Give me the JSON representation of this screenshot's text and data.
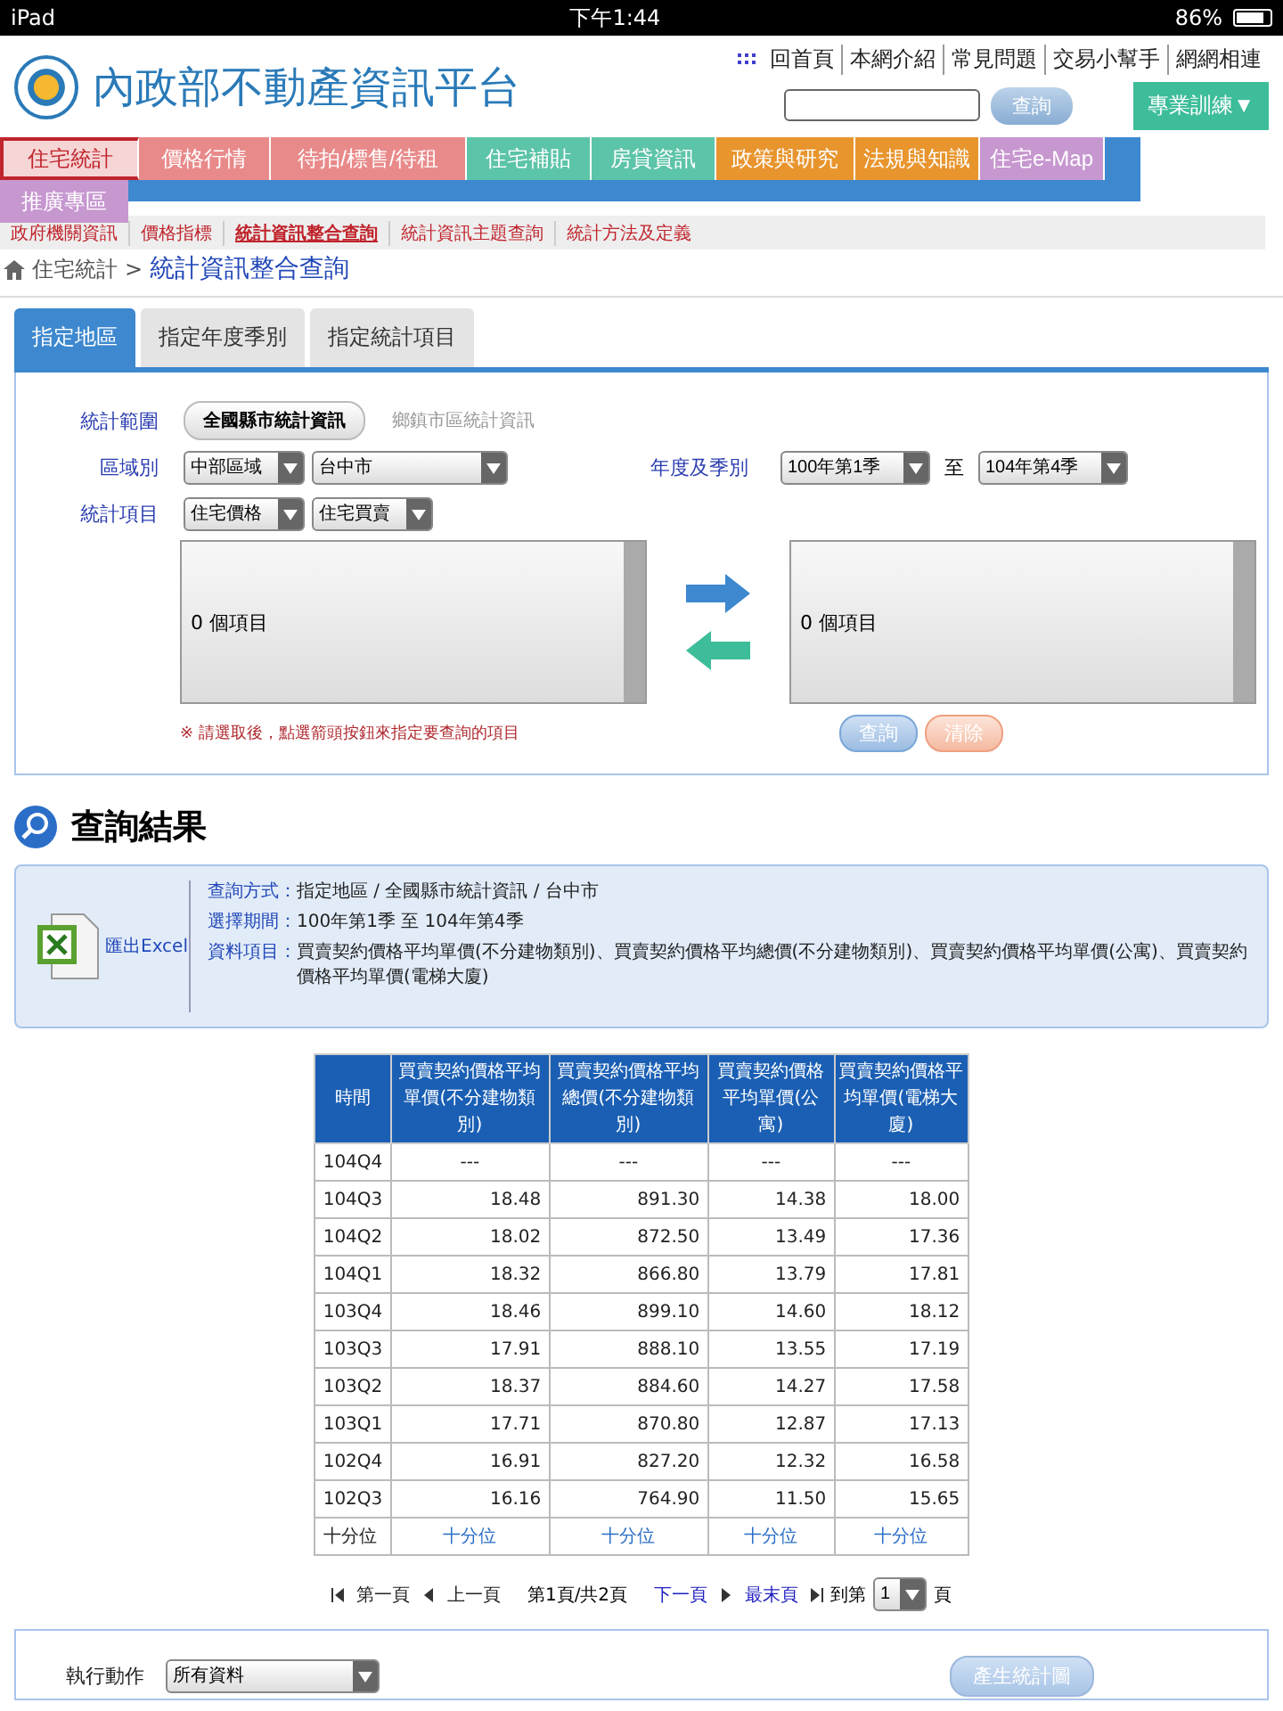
{
  "status_bar": {
    "device": "iPad",
    "time": "下午1:44",
    "battery": "86%"
  },
  "header": {
    "site_title": "內政部不動產資訊平台",
    "top_links": [
      "回首頁",
      "本網介紹",
      "常見問題",
      "交易小幫手",
      "網網相連"
    ],
    "search": {
      "button": "查詢"
    },
    "training_button": "專業訓練▼"
  },
  "nav": [
    {
      "label": "住宅統計",
      "color": "#f6d5d5",
      "selected": true
    },
    {
      "label": "價格行情",
      "color": "#e98a8a",
      "selected": false
    },
    {
      "label": "待拍/標售/待租",
      "color": "#e98a8a",
      "selected": false
    },
    {
      "label": "住宅補貼",
      "color": "#5cc4a8",
      "selected": false
    },
    {
      "label": "房貸資訊",
      "color": "#5cc4a8",
      "selected": false
    },
    {
      "label": "政策與研究",
      "color": "#e8952e",
      "selected": false
    },
    {
      "label": "法規與知識",
      "color": "#e8952e",
      "selected": false
    },
    {
      "label": "住宅e-Map",
      "color": "#c797d0",
      "selected": false
    },
    {
      "label": "推廣專區",
      "color": "#c797d0",
      "selected": false
    }
  ],
  "subnav": [
    {
      "label": "政府機關資訊",
      "selected": false
    },
    {
      "label": "價格指標",
      "selected": false
    },
    {
      "label": "統計資訊整合查詢",
      "selected": true
    },
    {
      "label": "統計資訊主題查詢",
      "selected": false
    },
    {
      "label": "統計方法及定義",
      "selected": false
    }
  ],
  "breadcrumb": {
    "parent": "住宅統計",
    "separator": ">",
    "current": "統計資訊整合查詢"
  },
  "query_tabs": [
    {
      "label": "指定地區",
      "selected": true
    },
    {
      "label": "指定年度季別",
      "selected": false
    },
    {
      "label": "指定統計項目",
      "selected": false
    }
  ],
  "form": {
    "scope_label": "統計範圍",
    "scope_options": [
      {
        "label": "全國縣市統計資訊",
        "selected": true
      },
      {
        "label": "鄉鎮市區統計資訊",
        "selected": false
      }
    ],
    "region_label": "區域別",
    "region_selects": [
      "中部區域",
      "台中市"
    ],
    "period_label": "年度及季別",
    "period_from": "100年第1季",
    "period_to_label": "至",
    "period_to": "104年第4季",
    "item_label": "統計項目",
    "item_selects": [
      "住宅價格",
      "住宅買賣"
    ],
    "left_list": "0 個項目",
    "right_list": "0 個項目",
    "note": "※ 請選取後，點選箭頭按鈕來指定要查詢的項目",
    "buttons": [
      "查詢",
      "清除"
    ]
  },
  "results": {
    "title": "查詢結果",
    "export": "匯出Excel",
    "info": [
      {
        "label": "查詢方式：",
        "value": "指定地區 / 全國縣市統計資訊 / 台中市"
      },
      {
        "label": "選擇期間：",
        "value": "100年第1季 至 104年第4季"
      },
      {
        "label": "資料項目：",
        "value": "買賣契約價格平均單價(不分建物類別)、買賣契約價格平均總價(不分建物類別)、買賣契約價格平均單價(公寓)、買賣契約價格平均單價(電梯大廈)"
      }
    ]
  },
  "table": {
    "columns": [
      "時間",
      "買賣契約價格平均單價(不分建物類別)",
      "買賣契約價格平均總價(不分建物類別)",
      "買賣契約價格平均單價(公寓)",
      "買賣契約價格平均單價(電梯大廈)"
    ],
    "rows": [
      [
        "104Q4",
        "---",
        "---",
        "---",
        "---"
      ],
      [
        "104Q3",
        "18.48",
        "891.30",
        "14.38",
        "18.00"
      ],
      [
        "104Q2",
        "18.02",
        "872.50",
        "13.49",
        "17.36"
      ],
      [
        "104Q1",
        "18.32",
        "866.80",
        "13.79",
        "17.81"
      ],
      [
        "103Q4",
        "18.46",
        "899.10",
        "14.60",
        "18.12"
      ],
      [
        "103Q3",
        "17.91",
        "888.10",
        "13.55",
        "17.19"
      ],
      [
        "103Q2",
        "18.37",
        "884.60",
        "14.27",
        "17.58"
      ],
      [
        "103Q1",
        "17.71",
        "870.80",
        "12.87",
        "17.13"
      ],
      [
        "102Q4",
        "16.91",
        "827.20",
        "12.32",
        "16.58"
      ],
      [
        "102Q3",
        "16.16",
        "764.90",
        "11.50",
        "15.65"
      ]
    ],
    "footer": [
      "十分位",
      "十分位",
      "十分位",
      "十分位",
      "十分位"
    ]
  },
  "pagination": {
    "first": "第一頁",
    "prev": "上一頁",
    "info": "第1頁/共2頁",
    "next": "下一頁",
    "last": "最末頁",
    "goto_label": "到第",
    "page_select": "1",
    "page_suffix": "頁"
  },
  "action": {
    "label": "執行動作",
    "select": "所有資料",
    "button": "產生統計圖"
  }
}
